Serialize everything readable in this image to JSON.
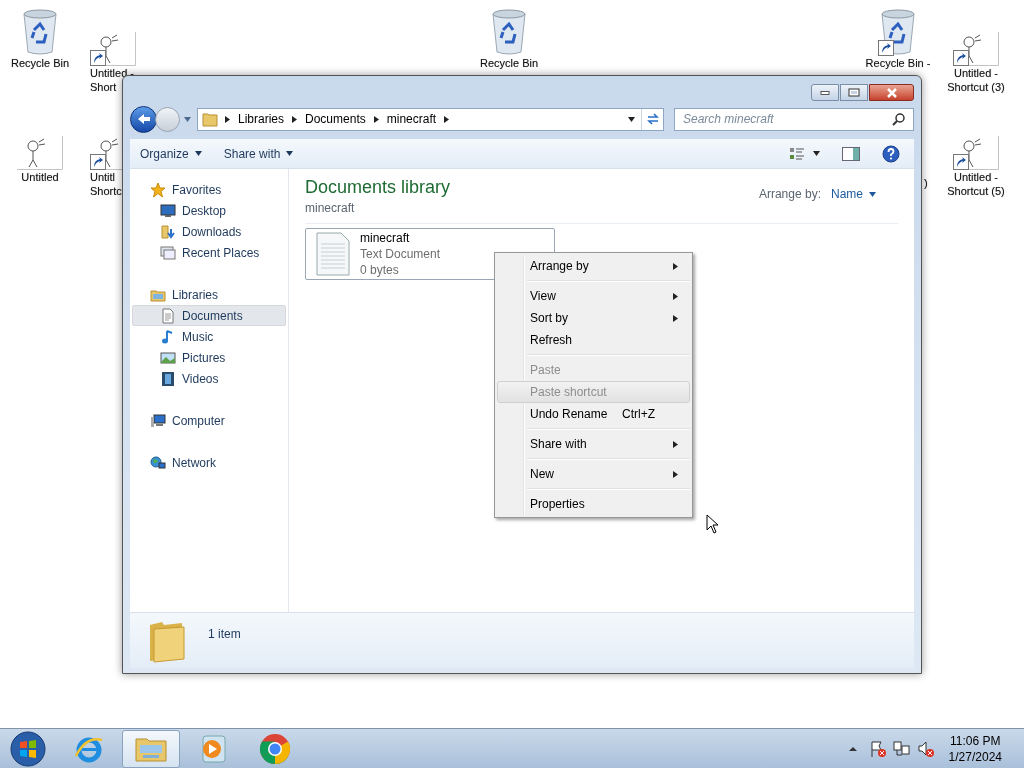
{
  "desktop_icons": [
    {
      "kind": "recycle",
      "shortcut": false,
      "label_lines": [
        "Recycle Bin"
      ]
    },
    {
      "kind": "drawing",
      "shortcut": true,
      "label_lines": [
        "Untitled -",
        "Short"
      ]
    },
    {
      "kind": "recycle",
      "shortcut": false,
      "label_lines": [
        "Recycle Bin"
      ]
    },
    {
      "kind": "recycle",
      "shortcut": true,
      "label_lines": [
        "Recycle Bin -"
      ]
    },
    {
      "kind": "drawing",
      "shortcut": true,
      "label_lines": [
        "Untitled -",
        "Shortcut (3)"
      ]
    },
    {
      "kind": "drawing",
      "shortcut": false,
      "label_lines": [
        "Untitled"
      ]
    },
    {
      "kind": "drawing",
      "shortcut": true,
      "label_lines": [
        "Untitl",
        "Shortc"
      ]
    },
    {
      "kind": "none",
      "label_lines": [
        ")"
      ]
    },
    {
      "kind": "drawing",
      "shortcut": true,
      "label_lines": [
        "Untitled -",
        "Shortcut (5)"
      ]
    }
  ],
  "window": {
    "address": {
      "crumbs": [
        "Libraries",
        "Documents",
        "minecraft"
      ]
    },
    "search": {
      "placeholder": "Search minecraft"
    },
    "toolbar": [
      "Organize",
      "Share with"
    ],
    "sidebar": [
      {
        "label": "Favorites",
        "selected": false,
        "children": [
          {
            "label": "Desktop",
            "selected": false
          },
          {
            "label": "Downloads",
            "selected": false
          },
          {
            "label": "Recent Places",
            "selected": false
          }
        ]
      },
      {
        "label": "Libraries",
        "selected": false,
        "children": [
          {
            "label": "Documents",
            "selected": true
          },
          {
            "label": "Music",
            "selected": false
          },
          {
            "label": "Pictures",
            "selected": false
          },
          {
            "label": "Videos",
            "selected": false
          }
        ]
      },
      {
        "label": "Computer",
        "selected": false
      },
      {
        "label": "Network",
        "selected": false
      }
    ],
    "content": {
      "title": "Documents library",
      "subtitle": "minecraft",
      "arrange_label": "Arrange by:",
      "arrange_value": "Name",
      "files": [
        {
          "name": "minecraft",
          "type": "Text Document",
          "size": "0 bytes",
          "selected": true
        }
      ]
    },
    "status": "1 item"
  },
  "context_menu": [
    [
      {
        "label": "Arrange by",
        "submenu": true,
        "disabled": false,
        "highlighted": false
      }
    ],
    [
      {
        "label": "View",
        "submenu": true,
        "disabled": false,
        "highlighted": false
      },
      {
        "label": "Sort by",
        "submenu": true,
        "disabled": false,
        "highlighted": false
      },
      {
        "label": "Refresh",
        "submenu": false,
        "disabled": false,
        "highlighted": false
      }
    ],
    [
      {
        "label": "Paste",
        "submenu": false,
        "disabled": true,
        "highlighted": false
      },
      {
        "label": "Paste shortcut",
        "submenu": false,
        "disabled": true,
        "highlighted": true
      },
      {
        "label": "Undo Rename",
        "shortcut": "Ctrl+Z",
        "submenu": false,
        "disabled": false,
        "highlighted": false
      }
    ],
    [
      {
        "label": "Share with",
        "submenu": true,
        "disabled": false,
        "highlighted": false
      }
    ],
    [
      {
        "label": "New",
        "submenu": true,
        "disabled": false,
        "highlighted": false
      }
    ],
    [
      {
        "label": "Properties",
        "submenu": false,
        "disabled": false,
        "highlighted": false
      }
    ]
  ],
  "taskbar": {
    "items": [
      {
        "kind": "ie",
        "selected": false
      },
      {
        "kind": "explorer",
        "selected": true
      },
      {
        "kind": "media",
        "selected": false
      },
      {
        "kind": "chrome",
        "selected": false
      }
    ],
    "clock": {
      "time": "11:06 PM",
      "date": "1/27/2024"
    }
  }
}
